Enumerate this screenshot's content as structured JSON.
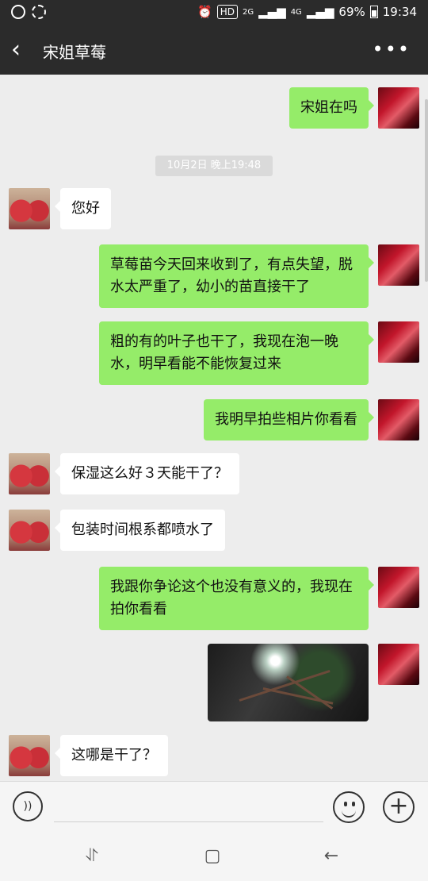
{
  "status_bar": {
    "battery": "69%",
    "time": "19:34",
    "hd": "HD",
    "signal_2g": "2G",
    "signal_4g": "4G"
  },
  "header": {
    "title": "宋姐草莓",
    "more_icon": "more-dots-icon",
    "back_icon": "back-arrow-icon"
  },
  "timestamp": "10月2日 晚上19:48",
  "messages": [
    {
      "from": "me",
      "text": "宋姐在吗"
    },
    {
      "from": "other",
      "text": "您好"
    },
    {
      "from": "me",
      "text": "草莓苗今天回来收到了，有点失望，脱水太严重了，幼小的苗直接干了"
    },
    {
      "from": "me",
      "text": "粗的有的叶子也干了，我现在泡一晚水，明早看能不能恢复过来"
    },
    {
      "from": "me",
      "text": "我明早拍些相片你看看"
    },
    {
      "from": "other",
      "text": "保湿这么好３天能干了？"
    },
    {
      "from": "other",
      "text": "包装时间根系都喷水了"
    },
    {
      "from": "me",
      "text": "我跟你争论这个也没有意义的，我现在拍你看看"
    },
    {
      "from": "me",
      "type": "image"
    },
    {
      "from": "other",
      "text": "这哪是干了？"
    }
  ],
  "input_bar": {
    "voice_icon": "voice-icon",
    "emoji_icon": "emoji-icon",
    "plus_icon": "plus-icon"
  },
  "colors": {
    "my_bubble": "#95ec69",
    "other_bubble": "#ffffff",
    "header_bg": "#2b2b2b",
    "chat_bg": "#ededed"
  }
}
